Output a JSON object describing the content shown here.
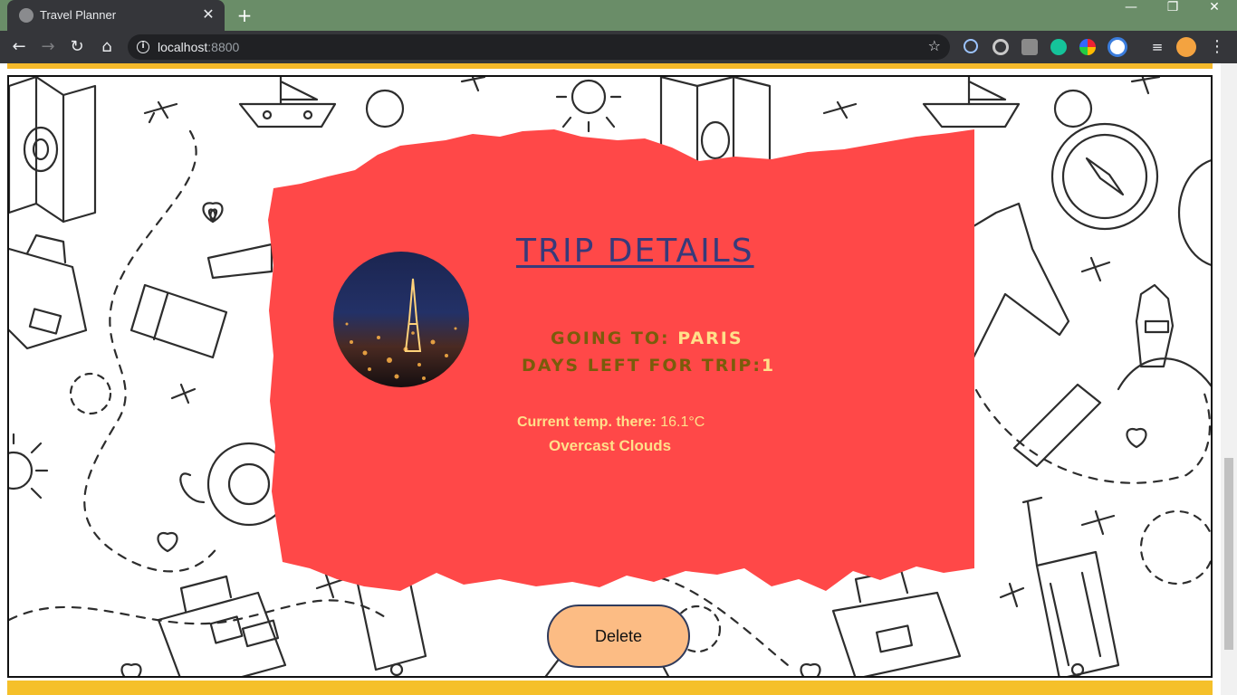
{
  "browser": {
    "tab_title": "Travel Planner",
    "url_host": "localhost",
    "url_port": ":8800"
  },
  "card": {
    "title": "TRIP DETAILS",
    "going_to_label": "GOING TO: ",
    "destination": "PARIS",
    "days_left_label": "DAYS LEFT FOR TRIP:",
    "days_left": "1",
    "temp_label": "Current temp. there: ",
    "temp_value": "16.1°C",
    "weather_description": "Overcast Clouds",
    "delete_label": "Delete"
  },
  "colors": {
    "card_bg": "#ff4848",
    "title": "#383a7a",
    "accent_strip": "#f5c02a",
    "button_bg": "#fcbc84"
  }
}
